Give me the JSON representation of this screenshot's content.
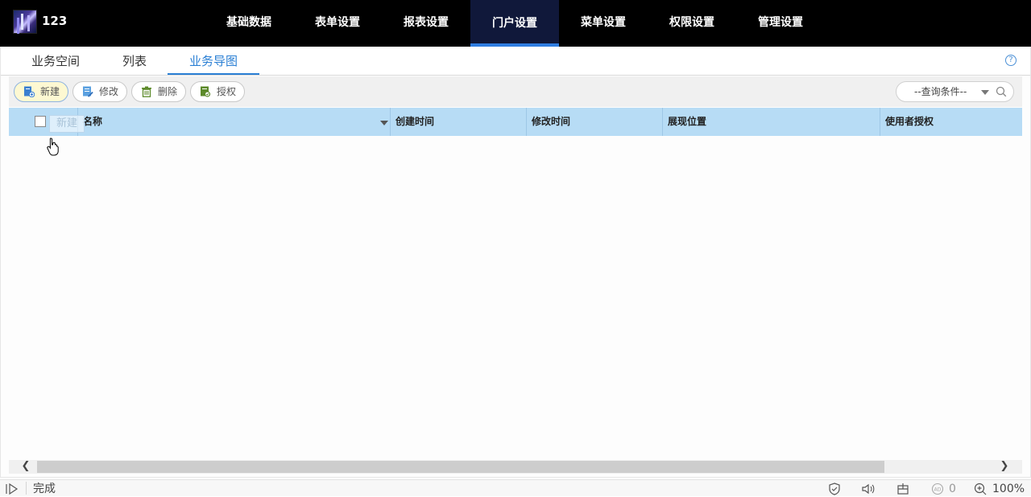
{
  "app": {
    "name": "123"
  },
  "nav": {
    "items": [
      "基础数据",
      "表单设置",
      "报表设置",
      "门户设置",
      "菜单设置",
      "权限设置",
      "管理设置"
    ],
    "active_index": 3
  },
  "subtabs": {
    "items": [
      "业务空间",
      "列表",
      "业务导图"
    ],
    "active_index": 2
  },
  "toolbar": {
    "new_label": "新建",
    "edit_label": "修改",
    "delete_label": "删除",
    "grant_label": "授权",
    "query_select": "--查询条件--"
  },
  "grid": {
    "columns": [
      "名称",
      "创建时间",
      "修改时间",
      "展现位置",
      "使用者授权"
    ],
    "drag_ghost": "新建"
  },
  "status": {
    "text": "完成",
    "ad_count": "0",
    "zoom": "100%"
  },
  "colors": {
    "topbar": "#000000",
    "nav_active": "#10183a",
    "accent": "#2a7fd4",
    "grid_header": "#b7dcf5"
  }
}
